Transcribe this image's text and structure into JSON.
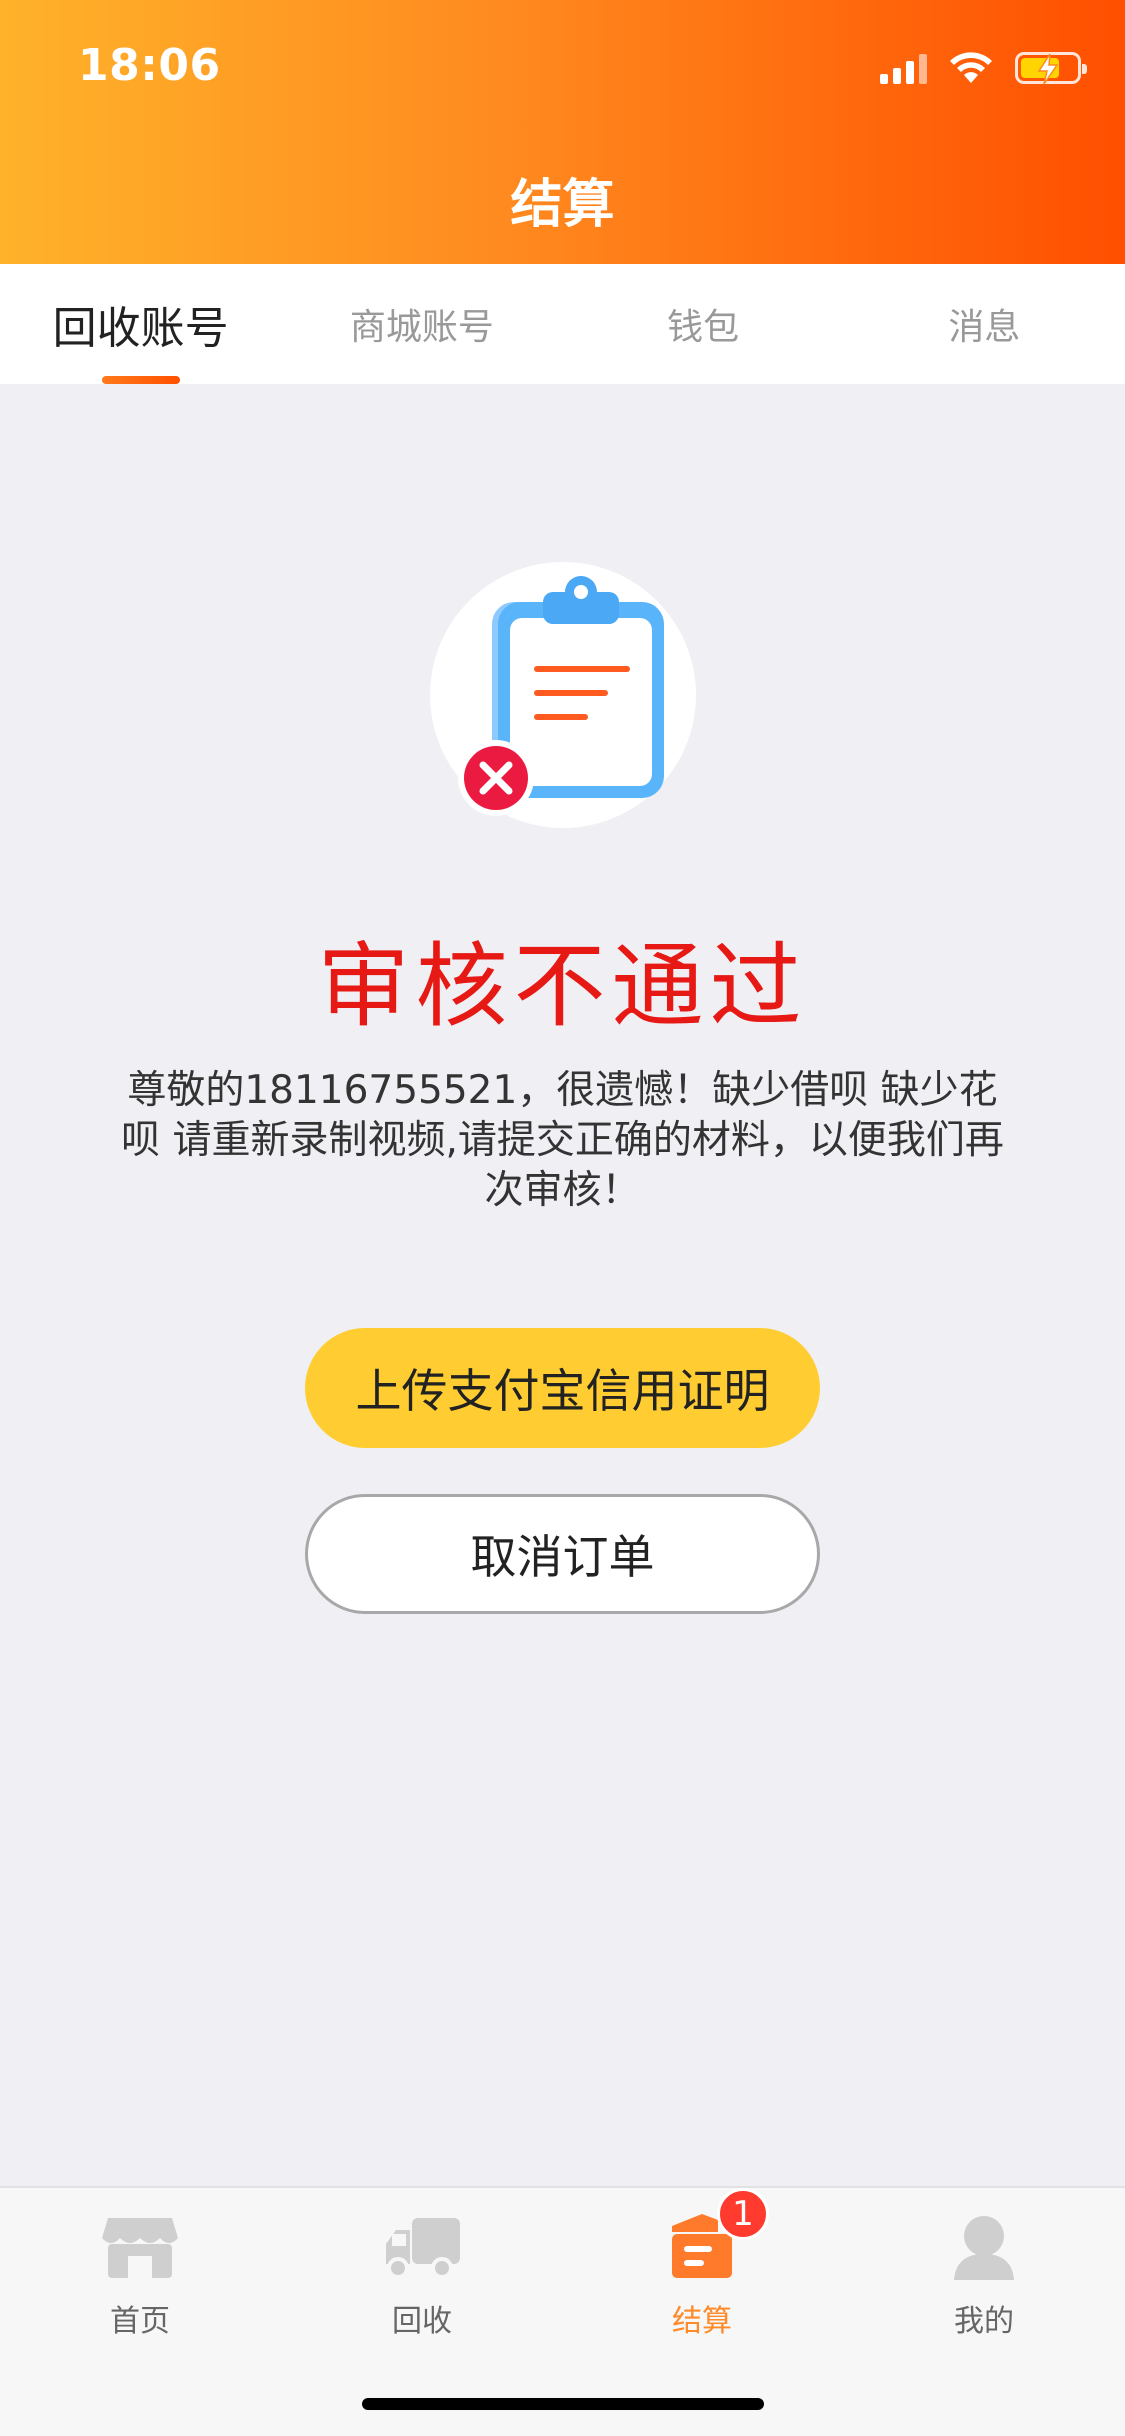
{
  "status_bar": {
    "time": "18:06"
  },
  "header": {
    "title": "结算"
  },
  "tabs": [
    {
      "label": "回收账号",
      "active": true
    },
    {
      "label": "商城账号",
      "active": false
    },
    {
      "label": "钱包",
      "active": false
    },
    {
      "label": "消息",
      "active": false
    }
  ],
  "illustration": {
    "icon": "clipboard-rejected-icon"
  },
  "result": {
    "title": "审核不通过",
    "description": "尊敬的18116755521，很遗憾！缺少借呗  缺少花呗 请重新录制视频,请提交正确的材料，以便我们再次审核！"
  },
  "buttons": {
    "upload_label": "上传支付宝信用证明",
    "cancel_label": "取消订单"
  },
  "bottom_nav": [
    {
      "label": "首页",
      "icon": "store-icon",
      "active": false
    },
    {
      "label": "回收",
      "icon": "truck-icon",
      "active": false
    },
    {
      "label": "结算",
      "icon": "settlement-icon",
      "active": true,
      "badge": "1"
    },
    {
      "label": "我的",
      "icon": "user-icon",
      "active": false
    }
  ],
  "colors": {
    "header_gradient_start": "#ffb22a",
    "header_gradient_end": "#ff4f00",
    "rejected_red": "#e61914",
    "primary_button": "#ffcd32",
    "active_nav": "#ff8a2a",
    "badge": "#ff3b30"
  }
}
